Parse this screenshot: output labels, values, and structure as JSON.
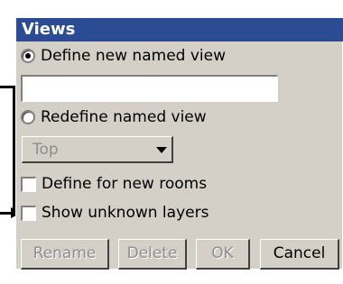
{
  "dialog": {
    "title": "Views",
    "options": {
      "define_new": {
        "label": "Define new named view",
        "selected": true
      },
      "redefine": {
        "label": "Redefine named view",
        "selected": false
      }
    },
    "name_field": {
      "value": "",
      "placeholder": ""
    },
    "view_select": {
      "value": "Top",
      "enabled": false
    },
    "checkboxes": [
      {
        "label": "Define for new rooms",
        "checked": false
      },
      {
        "label": "Show unknown layers",
        "checked": false
      }
    ],
    "buttons": {
      "rename": {
        "label": "Rename",
        "enabled": false
      },
      "delete": {
        "label": "Delete",
        "enabled": false
      },
      "ok": {
        "label": "OK",
        "enabled": false
      },
      "cancel": {
        "label": "Cancel",
        "enabled": true
      }
    }
  },
  "colors": {
    "title_bar": "#2b4b93",
    "panel": "#d4d0c8",
    "disabled_text": "#8e8e8e"
  }
}
